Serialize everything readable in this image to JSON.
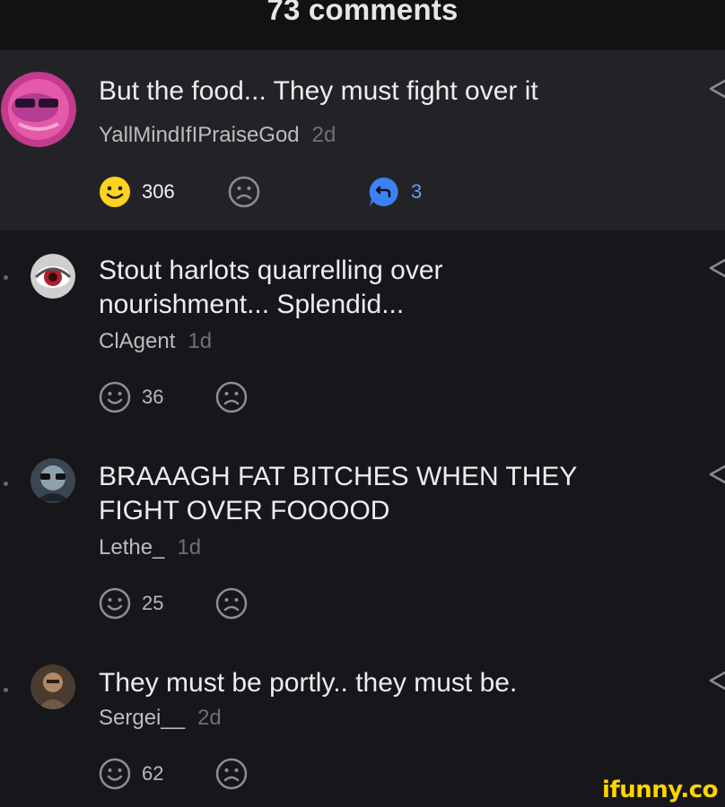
{
  "header": {
    "title": "73 comments"
  },
  "comments": [
    {
      "text": "But the food... They must fight over it",
      "username": "YallMindIfIPraiseGod",
      "age": "2d",
      "smile_count": "306",
      "reply_count": "3"
    },
    {
      "text": "Stout harlots quarrelling over nourishment... Splendid...",
      "username": "ClAgent",
      "age": "1d",
      "smile_count": "36"
    },
    {
      "text": "BRAAAGH FAT BITCHES WHEN THEY FIGHT OVER FOOOOD",
      "username": "Lethe_",
      "age": "1d",
      "smile_count": "25"
    },
    {
      "text": "They must be portly.. they must be.",
      "username": "Sergei__",
      "age": "2d",
      "smile_count": "62"
    }
  ],
  "watermark": "ifunny.co",
  "colors": {
    "background": "#17171b",
    "highlight": "#232327",
    "smile_active": "#ffd21f",
    "reply_blue": "#3d82f5"
  }
}
